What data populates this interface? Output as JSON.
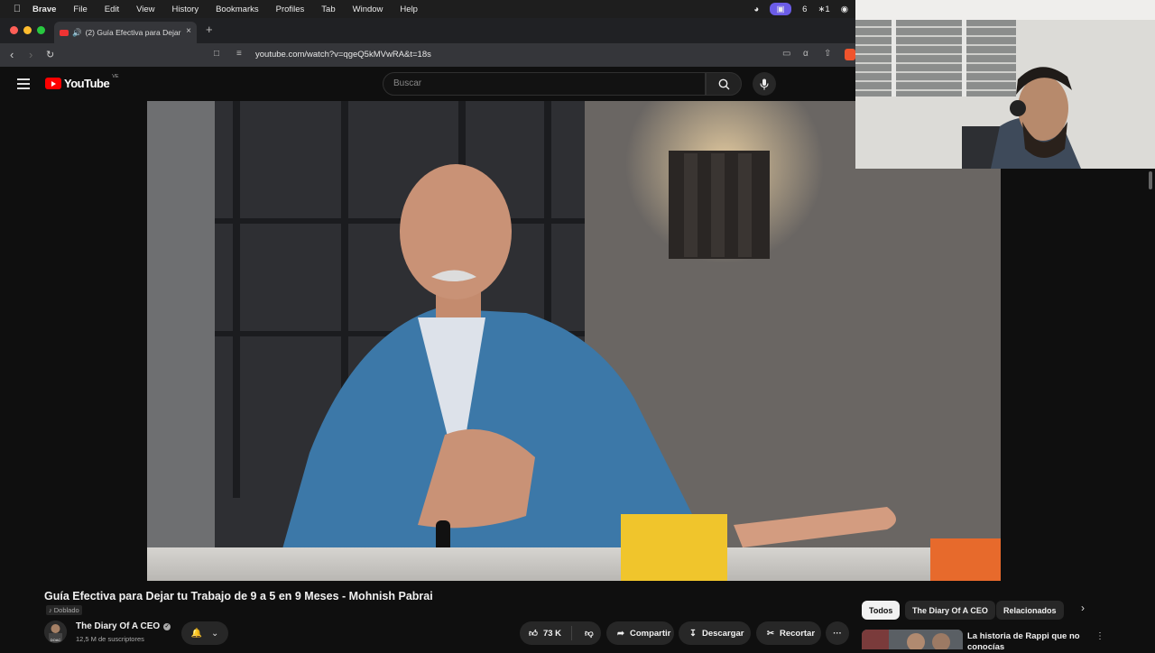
{
  "menubar": {
    "app": "Brave",
    "items": [
      "File",
      "Edit",
      "View",
      "History",
      "Bookmarks",
      "Profiles",
      "Tab",
      "Window",
      "Help"
    ],
    "status_number": "6",
    "status_extra": "∗1"
  },
  "tab": {
    "title": "(2) Guía Efectiva para Dejar",
    "close": "×",
    "new_tab": "+"
  },
  "addressbar": {
    "url": "youtube.com/watch?v=qgeQ5kMVwRA&t=18s"
  },
  "youtube": {
    "logo_text": "YouTube",
    "country_code": "VE",
    "search_placeholder": "Buscar"
  },
  "video": {
    "title": "Guía Efectiva para Dejar tu Trabajo de 9 a 5 en 9 Meses - Mohnish Pabrai",
    "badge": "Doblado",
    "channel": "The Diary Of A CEO",
    "subscribers": "12,5 M de suscriptores",
    "avatar_text": "DOAC",
    "likes": "73 K",
    "share": "Compartir",
    "download": "Descargar",
    "clip": "Recortar",
    "more": "···"
  },
  "chips": [
    "Todos",
    "The Diary Of A CEO",
    "Relacionados"
  ],
  "recommendation": {
    "title": "La historia de Rappi que no conocías"
  },
  "colors": {
    "background": "#0f0f0f",
    "youtube_red": "#ff0000",
    "brave_accent": "#f0542d"
  }
}
